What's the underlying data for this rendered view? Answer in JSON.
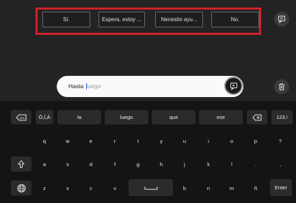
{
  "smart_replies": {
    "items": [
      {
        "label": "Sí."
      },
      {
        "label": "Espera, estoy ..."
      },
      {
        "label": "Necesito ayu..."
      },
      {
        "label": "No."
      }
    ]
  },
  "side_buttons": {
    "chat_icon": "chat-bubble-icon",
    "clear_icon": "trash-x-icon"
  },
  "message_input": {
    "typed_text": "Hasta ",
    "suggestion_text": "luego",
    "send_icon": "send-icon"
  },
  "keyboard": {
    "suggestion_row": {
      "abc_icon": "abc-backspace-icon",
      "accents_label": "Ó,Í,Á",
      "words": [
        "la",
        "luego",
        "que",
        "ese"
      ],
      "backspace_icon": "backspace-icon",
      "numbers_label": "123.!"
    },
    "row1": [
      "q",
      "w",
      "e",
      "r",
      "t",
      "y",
      "u",
      "i",
      "o",
      "p",
      "?"
    ],
    "row2": [
      "a",
      "s",
      "d",
      "f",
      "g",
      "h",
      "j",
      "k",
      "l",
      ".",
      ","
    ],
    "row2_shift_icon": "shift-arrow-icon",
    "row3_before_space": [
      "z",
      "x",
      "c",
      "v"
    ],
    "space_icon": "space-bar-icon",
    "row3_after_space": [
      "b",
      "n",
      "m",
      "ñ"
    ],
    "globe_icon": "globe-icon",
    "enter_label": "Enter"
  },
  "colors": {
    "highlight_border": "#d4202c",
    "caret": "#2f6cff"
  }
}
